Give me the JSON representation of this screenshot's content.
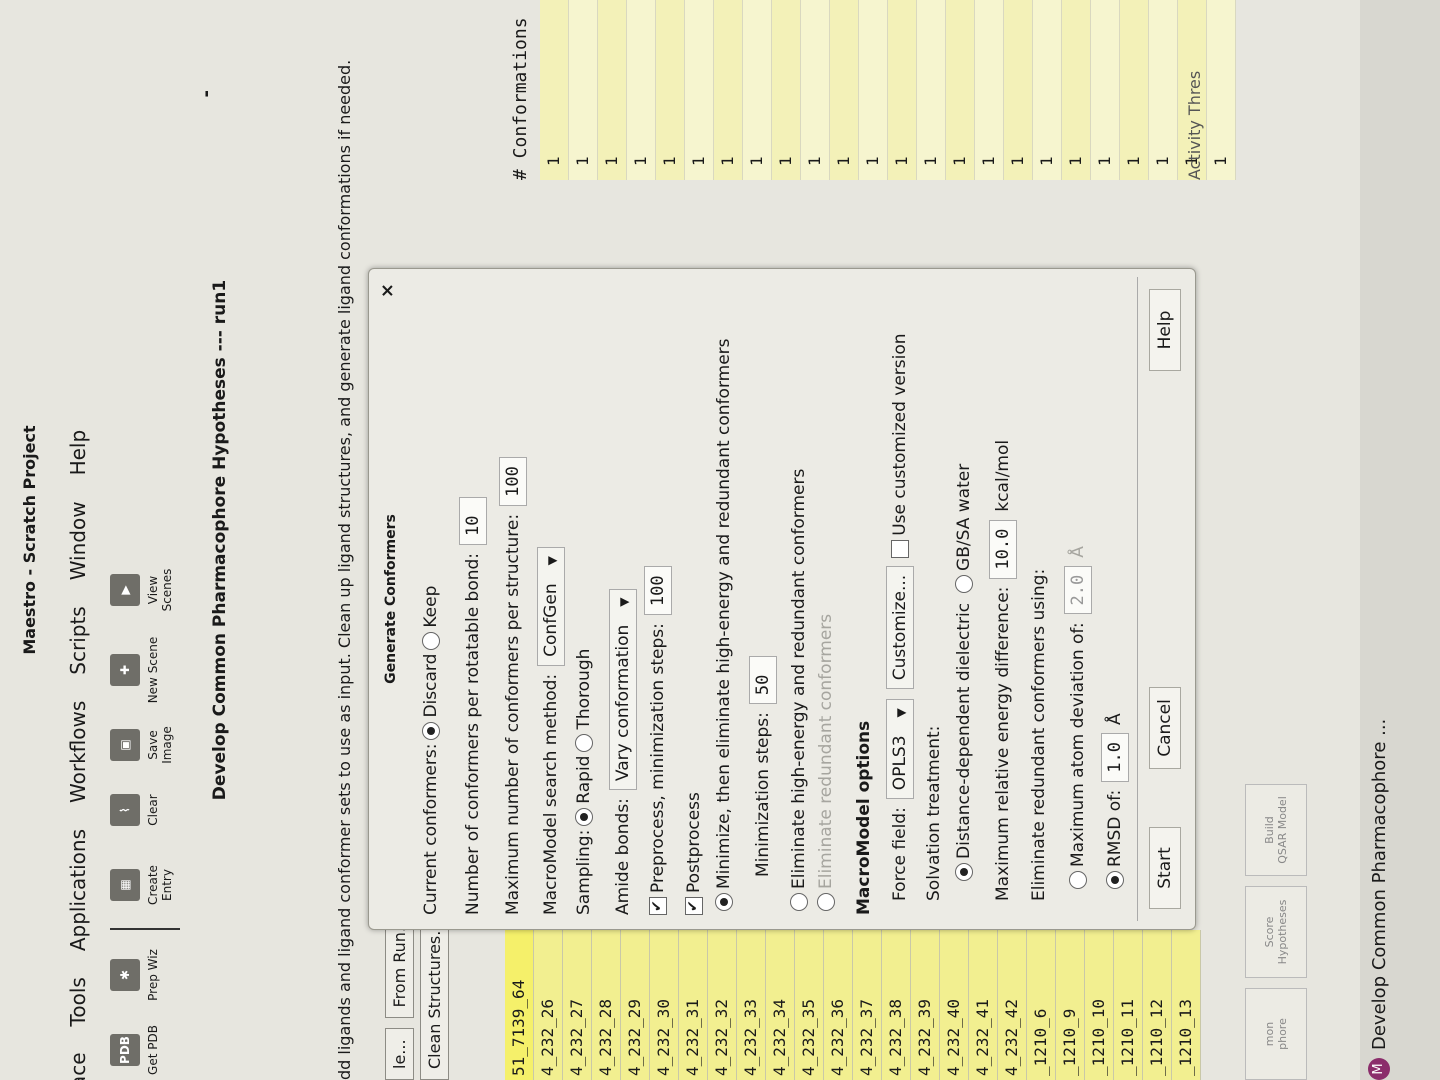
{
  "app": {
    "title": "Maestro - Scratch Project"
  },
  "menu": [
    "ace",
    "Tools",
    "Applications",
    "Workflows",
    "Scripts",
    "Window",
    "Help"
  ],
  "toolbar": [
    {
      "icon": "PDB",
      "label": "Get PDB"
    },
    {
      "icon": "",
      "label": "Prep Wiz"
    },
    {
      "icon": "",
      "label": "Create Entry"
    },
    {
      "icon": "",
      "label": "Clear"
    },
    {
      "icon": "",
      "label": "Save Image"
    },
    {
      "icon": "",
      "label": "New Scene"
    },
    {
      "icon": "",
      "label": "View Scenes"
    }
  ],
  "panel": {
    "title": "Develop Common Pharmacophore Hypotheses --- run1",
    "close": "-",
    "instruction": "dd ligands and ligand conformer sets to use as input.  Clean up ligand structures, and generate ligand conformations if needed.",
    "btn_file": "le...",
    "btn_from_run": "From Run...",
    "btn_clean": "Clean Structures..."
  },
  "table": {
    "ligands": [
      "51_7139_64",
      "4_232_26",
      "4_232_27",
      "4_232_28",
      "4_232_29",
      "4_232_30",
      "4_232_31",
      "4_232_32",
      "4_232_33",
      "4_232_34",
      "4_232_35",
      "4_232_36",
      "4_232_37",
      "4_232_38",
      "4_232_39",
      "4_232_40",
      "4_232_41",
      "4_232_42",
      "_1210_6",
      "_1210_9",
      "_1210_10",
      "_1210_11",
      "_1210_12",
      "_1210_13"
    ],
    "conf_header": "# Conformations",
    "conformations": [
      "1",
      "1",
      "1",
      "1",
      "1",
      "1",
      "1",
      "1",
      "1",
      "1",
      "1",
      "1",
      "1",
      "1",
      "1",
      "1",
      "1",
      "1",
      "1",
      "1",
      "1",
      "1",
      "1",
      "1"
    ],
    "activity": "Activity Thres"
  },
  "steps": [
    {
      "label": "mon\nphore"
    },
    {
      "label": "Score\nHypotheses"
    },
    {
      "label": "Build\nQSAR Model"
    }
  ],
  "taskbar": {
    "icon": "M",
    "label": "Develop Common Pharmacophore ..."
  },
  "dialog": {
    "title": "Generate Conformers",
    "close": "×",
    "current_label": "Current conformers:",
    "current_opt1": "Discard",
    "current_opt2": "Keep",
    "per_bond_label": "Number of conformers per rotatable bond:",
    "per_bond_value": "10",
    "max_label": "Maximum number of conformers per structure:",
    "max_value": "100",
    "method_label": "MacroModel search method:",
    "method_value": "ConfGen",
    "sampling_label": "Sampling:",
    "sampling_opt1": "Rapid",
    "sampling_opt2": "Thorough",
    "amide_label": "Amide bonds:",
    "amide_value": "Vary conformation",
    "preprocess_label": "Preprocess, minimization steps:",
    "preprocess_value": "100",
    "postprocess_label": "Postprocess",
    "post_opt1": "Minimize, then eliminate high-energy and redundant conformers",
    "min_steps_label": "Minimization steps:",
    "min_steps_value": "50",
    "post_opt2": "Eliminate high-energy and redundant conformers",
    "post_opt3": "Eliminate redundant conformers",
    "mm_section": "MacroModel options",
    "ff_label": "Force field:",
    "ff_value": "OPLS3",
    "customize": "Customize...",
    "custom_version": "Use customized version",
    "solv_label": "Solvation treatment:",
    "solv_opt1": "Distance-dependent dielectric",
    "solv_opt2": "GB/SA water",
    "energy_label": "Maximum relative energy difference:",
    "energy_value": "10.0",
    "energy_unit": "kcal/mol",
    "redundant_label": "Eliminate redundant conformers using:",
    "atom_dev_label": "Maximum atom deviation of:",
    "atom_dev_value": "2.0",
    "atom_dev_unit": "Å",
    "rmsd_label": "RMSD of:",
    "rmsd_value": "1.0",
    "rmsd_unit": "Å",
    "btn_start": "Start",
    "btn_cancel": "Cancel",
    "btn_help": "Help"
  }
}
